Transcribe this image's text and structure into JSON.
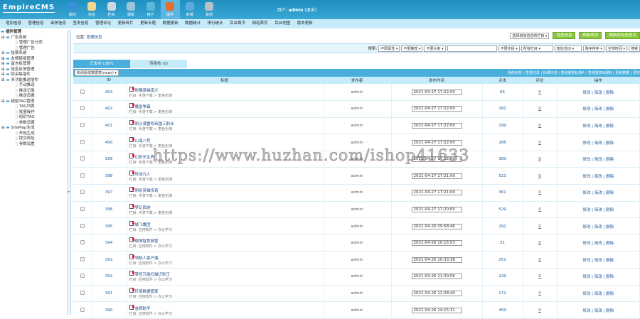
{
  "header": {
    "logo": "EmpireCMS",
    "user_label": "用户:",
    "user": "admin",
    "logout": "[退出]",
    "menu": [
      {
        "label": "系统",
        "color": "#3a8fd8"
      },
      {
        "label": "信息",
        "color": "#f0d890"
      },
      {
        "label": "栏目",
        "color": "#cfd8e0"
      },
      {
        "label": "模板",
        "color": "#9cc4d8"
      },
      {
        "label": "用户",
        "color": "#5ab8d8"
      },
      {
        "label": "插件",
        "color": "#e07030",
        "active": true
      },
      {
        "label": "商城",
        "color": "#5aa8e0"
      },
      {
        "label": "其他",
        "color": "#b8c0c8"
      }
    ]
  },
  "nav": [
    "增加信息",
    "管理信息",
    "审核信息",
    "签发信息",
    "管理评论",
    "更新碎片",
    "更新专题",
    "数据更新",
    "数据统计",
    "排行统计",
    "后台首页",
    "网站首页",
    "后台地图",
    "版本更新"
  ],
  "sidebar": [
    {
      "label": "插件管理",
      "lvl": 0
    },
    {
      "label": "广告系统",
      "lvl": 1
    },
    {
      "label": "管理广告分类",
      "lvl": 2
    },
    {
      "label": "管理广告",
      "lvl": 2
    },
    {
      "label": "投票系统",
      "lvl": 1
    },
    {
      "label": "友情链接管理",
      "lvl": 1
    },
    {
      "label": "留言板管理",
      "lvl": 1
    },
    {
      "label": "信息反馈管理",
      "lvl": 1
    },
    {
      "label": "防采集插件",
      "lvl": 1
    },
    {
      "label": "多功能推送插件",
      "lvl": 1
    },
    {
      "label": "手动推送",
      "lvl": 2
    },
    {
      "label": "推送记录",
      "lvl": 2
    },
    {
      "label": "推送设置",
      "lvl": 2
    },
    {
      "label": "超级TAG管理",
      "lvl": 1
    },
    {
      "label": "TAG列表",
      "lvl": 2
    },
    {
      "label": "批量操作",
      "lvl": 2
    },
    {
      "label": "组织TAG",
      "lvl": 2
    },
    {
      "label": "参数设置",
      "lvl": 2
    },
    {
      "label": "SiteMap生成",
      "lvl": 1
    },
    {
      "label": "开始生成",
      "lvl": 2
    },
    {
      "label": "提交网址",
      "lvl": 2
    },
    {
      "label": "参数设置",
      "lvl": 2
    }
  ],
  "position": {
    "label": "位置:",
    "link": "管理信息"
  },
  "tools": {
    "column_select": "选择增加信息的栏目",
    "add": "增加信息",
    "refresh_home": "刷新首页",
    "refresh_all": "刷新所有信息页"
  },
  "search": {
    "label": "搜索:",
    "attr": "不限属性",
    "recommend": "不限推荐",
    "headline": "不限头条",
    "keyword": "",
    "field": "不限字段",
    "column": "所有栏目",
    "order_by": "按信息ID",
    "order": "降序排序",
    "time": "全部时间",
    "button": "搜索"
  },
  "tabs": {
    "published": "已发布 (387)",
    "pending": "待审核 (0)"
  },
  "table_select": "新闻系统数据表(news)",
  "links": "我的信息 | 签发信息 | 投稿信息 | 查询重复标题A | 查询重复标题B | 更新数据 | 预览",
  "columns": {
    "id": "ID",
    "title": "标题",
    "author": "发布者",
    "time": "发布时间",
    "hits": "点击",
    "comments": "评论",
    "ops": "操作"
  },
  "ops": "修改 | 简改 | 删除",
  "rows": [
    {
      "id": "403",
      "title": "射雕英雄演义",
      "cat": "栏目: 手游下载 > 角色扮演",
      "author": "admin",
      "time": "2021-04-27 17:22:00",
      "hits": "65",
      "comments": "0"
    },
    {
      "id": "402",
      "title": "魔兽争霸",
      "cat": "栏目: 手游下载 > 角色扮演",
      "author": "admin",
      "time": "2021-04-27 17:22:00",
      "hits": "282",
      "comments": "0"
    },
    {
      "id": "401",
      "title": "刺沙漠雷鸣帝国三职业",
      "cat": "栏目: 手游下载 > 角色扮演",
      "author": "admin",
      "time": "2021-04-27 17:22:00",
      "hits": "199",
      "comments": "0"
    },
    {
      "id": "400",
      "title": "山海八荒",
      "cat": "栏目: 手游下载 > 角色扮演",
      "author": "admin",
      "time": "2021-04-27 17:22:00",
      "hits": "286",
      "comments": "0"
    },
    {
      "id": "399",
      "title": "幻世长生界",
      "cat": "栏目: 手游下载 > 角色扮演",
      "author": "admin",
      "time": "2021-04-27 17:22:00",
      "hits": "383",
      "comments": "0"
    },
    {
      "id": "398",
      "title": "修成凡人",
      "cat": "栏目: 手游下载 > 角色扮演",
      "author": "admin",
      "time": "2021-04-27 17:21:00",
      "hits": "523",
      "comments": "0"
    },
    {
      "id": "397",
      "title": "刺杀英雄传奇",
      "cat": "栏目: 手游下载 > 角色扮演",
      "author": "admin",
      "time": "2021-04-27 17:21:00",
      "hits": "361",
      "comments": "0"
    },
    {
      "id": "396",
      "title": "梦幻西游",
      "cat": "栏目: 手游下载 > 角色扮演",
      "author": "admin",
      "time": "2021-04-27 17:20:00",
      "hits": "529",
      "comments": "0"
    },
    {
      "id": "395",
      "title": "城飞鹰团",
      "cat": "栏目: 应用软件 > 办公学习",
      "author": "admin",
      "time": "2021-04-26 09:58:46",
      "hits": "292",
      "comments": "0"
    },
    {
      "id": "394",
      "title": "微博智慧城管",
      "cat": "栏目: 应用软件 > 办公学习",
      "author": "admin",
      "time": "2021-04-26 10:15:03",
      "hits": "21",
      "comments": "0"
    },
    {
      "id": "393",
      "title": "领航人客户端",
      "cat": "栏目: 应用软件 > 办公学习",
      "author": "admin",
      "time": "2021-04-26 10:33:38",
      "hits": "251",
      "comments": "0"
    },
    {
      "id": "392",
      "title": "掌控万能扫描识别王",
      "cat": "栏目: 应用软件 > 办公学习",
      "author": "admin",
      "time": "2021-04-26 11:00:56",
      "hits": "229",
      "comments": "0"
    },
    {
      "id": "391",
      "title": "环境数据管家",
      "cat": "栏目: 应用软件 > 办公学习",
      "author": "admin",
      "time": "2021-04-26 12:28:40",
      "hits": "172",
      "comments": "0"
    },
    {
      "id": "390",
      "title": "金牌助手",
      "cat": "栏目: 应用软件 > 办公学习",
      "author": "admin",
      "time": "2021-04-26 14:15:31",
      "hits": "459",
      "comments": "0"
    }
  ],
  "watermark": "https://www.huzhan.com/ishop41633"
}
